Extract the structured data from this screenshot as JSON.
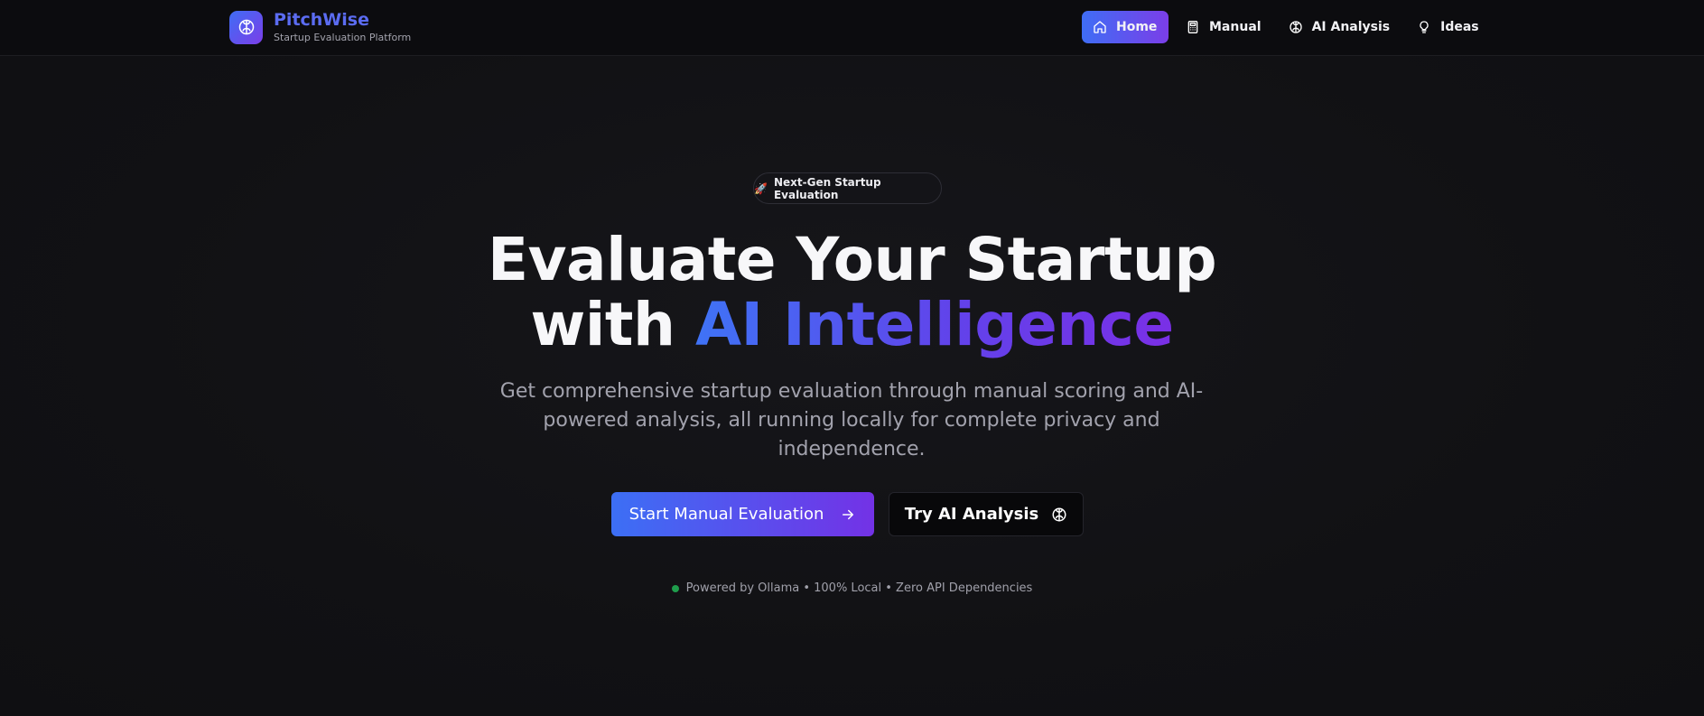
{
  "header": {
    "brand_name": "PitchWise",
    "brand_tagline": "Startup Evaluation Platform",
    "logo_icon": "brain-icon",
    "nav": [
      {
        "label": "Home",
        "icon": "home-icon",
        "active": true
      },
      {
        "label": "Manual",
        "icon": "calculator-icon",
        "active": false
      },
      {
        "label": "AI Analysis",
        "icon": "brain-icon",
        "active": false
      },
      {
        "label": "Ideas",
        "icon": "lightbulb-icon",
        "active": false
      }
    ]
  },
  "hero": {
    "badge_emoji": "🚀",
    "badge_text": "Next-Gen Startup Evaluation",
    "headline_line1": "Evaluate Your Startup",
    "headline_line2_plain": "with",
    "headline_line2_highlight": "AI Intelligence",
    "subtext": "Get comprehensive startup evaluation through manual scoring and AI-powered analysis, all running locally for complete privacy and independence.",
    "primary_button": {
      "label": "Start Manual Evaluation",
      "icon": "arrow-right-icon"
    },
    "secondary_button": {
      "label": "Try AI Analysis",
      "icon": "brain-icon"
    },
    "footnote": "Powered by Ollama • 100% Local • Zero API Dependencies"
  },
  "colors": {
    "background": "#111114",
    "accent_start": "#3f6df5",
    "accent_end": "#7b3ee8",
    "status_green": "#1f9d4c"
  }
}
